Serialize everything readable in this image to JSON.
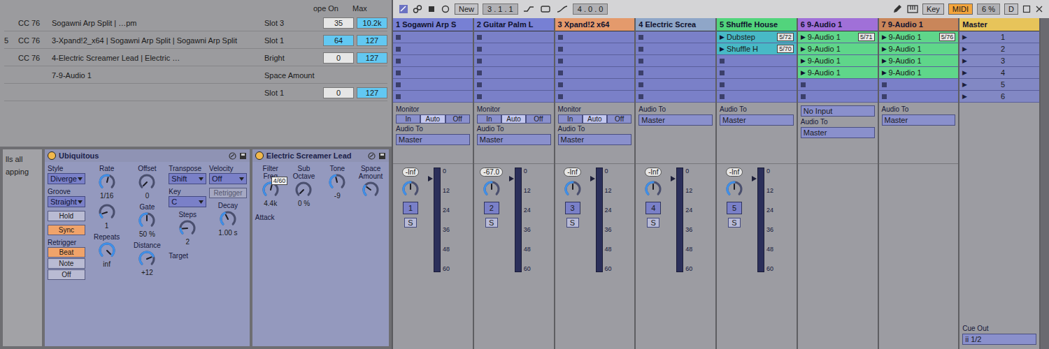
{
  "transport": {
    "position": "3 . 1 . 1",
    "new_button": "New",
    "loop_length": "4 . 0 . 0",
    "key_button": {
      "label": "Key",
      "selected": false
    },
    "midi_button": {
      "label": "MIDI",
      "selected": true
    },
    "cpu": "6 %",
    "d_button": "D"
  },
  "play_icon": "▶",
  "mapping_table": {
    "header": {
      "left": "ope On",
      "max": "Max"
    },
    "rows": [
      {
        "num": "",
        "source": "CC 76",
        "path": "Sogawni Arp Split | …pm",
        "name": "Slot 3",
        "min": {
          "value": "35",
          "highlighted": false
        },
        "max": {
          "value": "10.2k",
          "highlighted": true
        }
      },
      {
        "num": "5",
        "source": "CC 76",
        "path": "3-Xpand!2_x64 | Sogawni Arp Split | Sogawni Arp Split",
        "name": "Slot 1",
        "min": {
          "value": "64",
          "highlighted": true
        },
        "max": {
          "value": "127",
          "highlighted": true
        }
      },
      {
        "num": "",
        "source": "CC 76",
        "path": "4-Electric Screamer Lead | Electric …",
        "name": "Bright",
        "min": {
          "value": "0",
          "highlighted": false
        },
        "max": {
          "value": "127",
          "highlighted": true
        }
      },
      {
        "num": "",
        "source": "",
        "path": "7-9-Audio 1",
        "name": "Space Amount"
      },
      {
        "num": "",
        "source": "",
        "path": "",
        "name": "Slot 1",
        "min": {
          "value": "0",
          "highlighted": false
        },
        "max": {
          "value": "127",
          "highlighted": true
        }
      }
    ]
  },
  "side_panel": {
    "lines": [
      "lls all",
      "apping"
    ]
  },
  "devices": [
    {
      "title": "Ubiquitous",
      "on": true,
      "columns": [
        [
          {
            "kind": "dropdown",
            "label": "Style",
            "value": "Diverge"
          },
          {
            "kind": "dropdown",
            "label": "Groove",
            "value": "Straight"
          },
          {
            "kind": "toggle",
            "value": "Hold",
            "selected": false,
            "disabled": false
          },
          {
            "kind": "toggle",
            "value": "Sync",
            "selected": true,
            "disabled": false
          },
          {
            "kind": "choice",
            "label": "Retrigger",
            "options": [
              {
                "label": "Beat",
                "selected": true
              },
              {
                "label": "Note",
                "selected": false
              },
              {
                "label": "Off",
                "selected": false
              }
            ]
          }
        ],
        [
          {
            "kind": "knob",
            "label": "Rate",
            "value": "1/16",
            "level": 0.55
          },
          {
            "kind": "knob",
            "value": "1",
            "level": 0.1
          },
          {
            "kind": "knob",
            "label": "Repeats",
            "value": "inf",
            "level": 1
          }
        ],
        [
          {
            "kind": "knob",
            "label": "Offset",
            "value": "0",
            "level": 0
          },
          {
            "kind": "knob",
            "label": "Gate",
            "value": "50 %",
            "level": 0.5
          },
          {
            "kind": "knob",
            "label": "Distance",
            "value": "+12",
            "level": 0.75
          }
        ],
        [
          {
            "kind": "dropdown",
            "label": "Transpose",
            "value": "Shift"
          },
          {
            "kind": "dropdown",
            "label": "Key",
            "value": "C"
          },
          {
            "kind": "knob",
            "label": "Steps",
            "value": "2",
            "level": 0.15
          },
          {
            "kind": "label",
            "label": "Target"
          }
        ],
        [
          {
            "kind": "dropdown",
            "label": "Velocity",
            "value": "Off"
          },
          {
            "kind": "toggle",
            "value": "Retrigger",
            "selected": false,
            "disabled": true
          },
          {
            "kind": "knob",
            "label": "Decay",
            "value": "1.00 s",
            "level": 0.4
          }
        ]
      ]
    },
    {
      "title": "Electric Screamer Lead",
      "on": true,
      "columns": [
        [
          {
            "kind": "knob",
            "label": "Filter Freq",
            "value": "4.4k",
            "level": 0.55,
            "badge": "4/60"
          },
          {
            "kind": "label",
            "label": "Attack"
          }
        ],
        [
          {
            "kind": "knob",
            "label": "Sub Octave",
            "value": "0 %",
            "level": 0
          }
        ],
        [
          {
            "kind": "knob",
            "label": "Tone",
            "value": "-9",
            "level": 0.45
          }
        ],
        [
          {
            "kind": "knob",
            "label": "Space Amount",
            "level": 0.3
          }
        ]
      ]
    }
  ],
  "meter_scale": [
    "0",
    "12",
    "24",
    "36",
    "48",
    "60"
  ],
  "tracks": [
    {
      "name": "1 Sogawni Arp S",
      "color": "#7780d4",
      "clips": [
        {
          "kind": "empty"
        },
        {
          "kind": "empty"
        },
        {
          "kind": "empty"
        },
        {
          "kind": "empty"
        },
        {
          "kind": "empty"
        },
        {
          "kind": "empty"
        }
      ],
      "monitor": {
        "label": "Monitor",
        "options": [
          {
            "label": "In",
            "selected": false
          },
          {
            "label": "Auto",
            "selected": true
          },
          {
            "label": "Off",
            "selected": false
          }
        ]
      },
      "audio_to": {
        "label": "Audio To",
        "value": "Master"
      },
      "mixer": {
        "volume": "-Inf",
        "number": "1",
        "solo": "S",
        "level": 0.92,
        "pan": 0.5
      }
    },
    {
      "name": "2 Guitar Palm L",
      "color": "#7780d4",
      "clips": [
        {
          "kind": "empty"
        },
        {
          "kind": "empty"
        },
        {
          "kind": "empty"
        },
        {
          "kind": "empty"
        },
        {
          "kind": "empty"
        },
        {
          "kind": "empty"
        }
      ],
      "monitor": {
        "label": "Monitor",
        "options": [
          {
            "label": "In",
            "selected": false
          },
          {
            "label": "Auto",
            "selected": true
          },
          {
            "label": "Off",
            "selected": false
          }
        ]
      },
      "audio_to": {
        "label": "Audio To",
        "value": "Master"
      },
      "mixer": {
        "volume": "-67.0",
        "number": "2",
        "solo": "S",
        "level": 0.92,
        "pan": 0.5
      }
    },
    {
      "name": "3 Xpand!2 x64",
      "color": "#e49a6c",
      "clips": [
        {
          "kind": "empty"
        },
        {
          "kind": "empty"
        },
        {
          "kind": "empty"
        },
        {
          "kind": "empty"
        },
        {
          "kind": "empty"
        },
        {
          "kind": "empty"
        }
      ],
      "monitor": {
        "label": "Monitor",
        "options": [
          {
            "label": "In",
            "selected": false
          },
          {
            "label": "Auto",
            "selected": true
          },
          {
            "label": "Off",
            "selected": false
          }
        ]
      },
      "audio_to": {
        "label": "Audio To",
        "value": "Master"
      },
      "mixer": {
        "volume": "-Inf",
        "number": "3",
        "solo": "S",
        "level": 0.92,
        "pan": 0.5
      }
    },
    {
      "name": "4 Electric Screa",
      "color": "#8fa6c8",
      "clips": [
        {
          "kind": "empty"
        },
        {
          "kind": "empty"
        },
        {
          "kind": "empty"
        },
        {
          "kind": "empty"
        },
        {
          "kind": "empty"
        },
        {
          "kind": "empty"
        }
      ],
      "audio_to": {
        "label": "Audio To",
        "value": "Master"
      },
      "mixer": {
        "volume": "-Inf",
        "number": "4",
        "solo": "S",
        "level": 0.92,
        "pan": 0.5
      }
    },
    {
      "name": "5 Shuffle House",
      "color": "#52d47c",
      "clips": [
        {
          "kind": "clip",
          "name": "Dubstep",
          "count": "5/72",
          "color": "#48b9c6"
        },
        {
          "kind": "clip",
          "name": "Shuffle H",
          "count": "5/70",
          "color": "#48b9c6"
        },
        {
          "kind": "empty"
        },
        {
          "kind": "empty"
        },
        {
          "kind": "empty"
        },
        {
          "kind": "empty"
        }
      ],
      "audio_to": {
        "label": "Audio To",
        "value": "Master"
      },
      "mixer": {
        "volume": "-Inf",
        "number": "5",
        "solo": "S",
        "level": 0.92,
        "pan": 0.5
      }
    },
    {
      "name": "6 9-Audio 1",
      "color": "#a070d8",
      "clips": [
        {
          "kind": "clip",
          "name": "9-Audio 1",
          "count": "5/71",
          "color": "#5fd68a"
        },
        {
          "kind": "clip",
          "name": "9-Audio 1",
          "count": "",
          "color": "#5fd68a"
        },
        {
          "kind": "clip",
          "name": "9-Audio 1",
          "count": "",
          "color": "#5fd68a"
        },
        {
          "kind": "clip",
          "name": "9-Audio 1",
          "count": "",
          "color": "#5fd68a"
        },
        {
          "kind": "empty"
        },
        {
          "kind": "empty"
        }
      ],
      "input": "No Input",
      "audio_to": {
        "label": "Audio To",
        "value": "Master"
      }
    },
    {
      "name": "7 9-Audio 1",
      "color": "#c9865a",
      "clips": [
        {
          "kind": "clip",
          "name": "9-Audio 1",
          "count": "5/76",
          "color": "#5fd68a"
        },
        {
          "kind": "clip",
          "name": "9-Audio 1",
          "count": "",
          "color": "#5fd68a"
        },
        {
          "kind": "clip",
          "name": "9-Audio 1",
          "count": "",
          "color": "#5fd68a"
        },
        {
          "kind": "clip",
          "name": "9-Audio 1",
          "count": "",
          "color": "#5fd68a"
        },
        {
          "kind": "empty"
        },
        {
          "kind": "empty"
        }
      ],
      "audio_to": {
        "label": "Audio To",
        "value": "Master"
      }
    }
  ],
  "master": {
    "name": "Master",
    "color": "#e7c45a",
    "scenes": [
      "1",
      "2",
      "3",
      "4",
      "5",
      "6"
    ],
    "cue_out": {
      "label": "Cue Out",
      "value": "ii 1/2"
    }
  }
}
